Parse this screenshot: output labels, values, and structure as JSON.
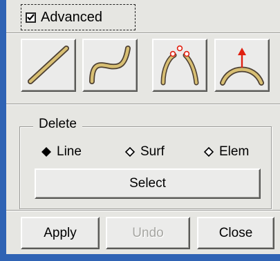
{
  "advanced": {
    "label": "Advanced",
    "checked": true
  },
  "tools": [
    {
      "icon": "straight-line-icon"
    },
    {
      "icon": "s-curve-icon"
    },
    {
      "icon": "control-points-curve-icon"
    },
    {
      "icon": "arc-normal-icon"
    }
  ],
  "delete_group": {
    "title": "Delete",
    "options": [
      {
        "label": "Line",
        "selected": true
      },
      {
        "label": "Surf",
        "selected": false
      },
      {
        "label": "Elem",
        "selected": false
      }
    ],
    "select_label": "Select"
  },
  "footer": {
    "apply_label": "Apply",
    "undo_label": "Undo",
    "undo_enabled": false,
    "close_label": "Close"
  },
  "colors": {
    "accent_blue": "#2f63b4",
    "curve_fill": "#d8bf73",
    "curve_outline": "#4d4033",
    "arrow_red": "#e02010"
  }
}
